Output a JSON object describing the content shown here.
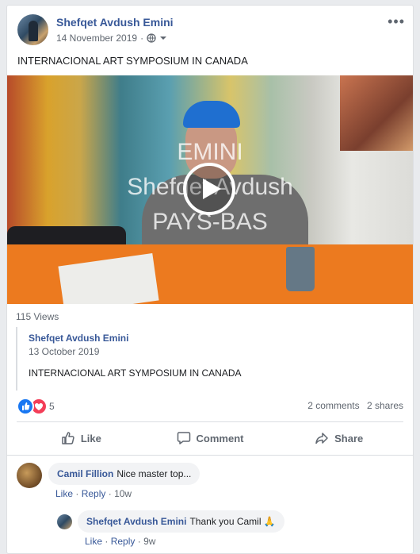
{
  "post": {
    "author": "Shefqet Avdush Emini",
    "date": "14 November 2019",
    "more_icon": "•••",
    "text": "INTERNACIONAL ART SYMPOSIUM IN CANADA",
    "video": {
      "watermark_line1": "EMINI",
      "watermark_line2": "Shefqet Avdush",
      "watermark_line3": "PAYS-BAS"
    },
    "views": "115 Views",
    "shared": {
      "author": "Shefqet Avdush Emini",
      "date": "13 October 2019",
      "text": "INTERNACIONAL ART SYMPOSIUM IN CANADA"
    },
    "reaction_count": "5",
    "comments_count": "2 comments",
    "shares_count": "2 shares",
    "actions": {
      "like": "Like",
      "comment": "Comment",
      "share": "Share"
    }
  },
  "comments": [
    {
      "name": "Camil Fillion",
      "text": "Nice master top...",
      "like": "Like",
      "reply": "Reply",
      "time": "10w",
      "sep": "·"
    },
    {
      "name": "Shefqet Avdush Emini",
      "text": "Thank you Camil 🙏",
      "like": "Like",
      "reply": "Reply",
      "time": "9w",
      "sep": "·"
    }
  ],
  "colors": {
    "link": "#385898",
    "like_blue": "#1877f2",
    "love_red": "#f33e58"
  }
}
